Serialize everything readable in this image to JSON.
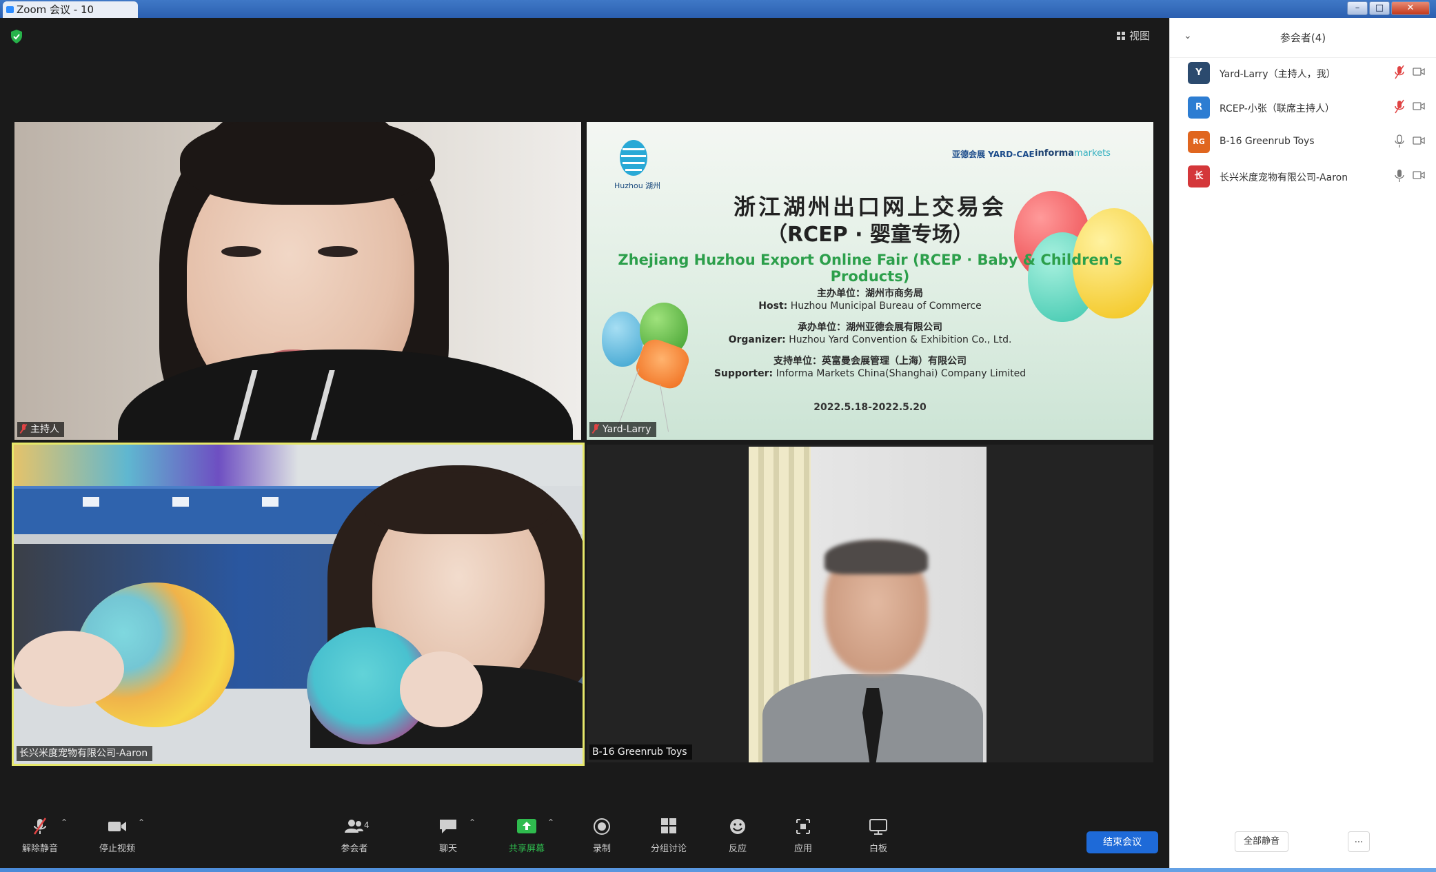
{
  "window": {
    "title": "Zoom 会议 - 10",
    "minimize": "–",
    "maximize": "□",
    "close": "✕"
  },
  "meeting": {
    "view_label": "视图",
    "tiles": [
      {
        "name": "主持人"
      },
      {
        "name": "Yard-Larry"
      },
      {
        "name": "长兴米度宠物有限公司-Aaron"
      },
      {
        "name": "B-16 Greenrub Toys"
      }
    ],
    "slide": {
      "left_logo_text": "Huzhou 湖州",
      "yard_logo": "亚德会展 YARD-CAE",
      "informa_logo_a": "informa",
      "informa_logo_b": "markets",
      "title_cn": "浙江湖州出口网上交易会",
      "subtitle_cn": "（RCEP · 婴童专场）",
      "title_en": "Zhejiang Huzhou Export Online Fair (RCEP · Baby & Children's Products)",
      "host_cn": "主办单位：湖州市商务局",
      "host_en_label": "Host:",
      "host_en": "Huzhou Municipal Bureau of Commerce",
      "org_cn": "承办单位：湖州亚德会展有限公司",
      "org_en_label": "Organizer:",
      "org_en": "Huzhou Yard Convention & Exhibition Co., Ltd.",
      "sup_cn": "支持单位：英富曼会展管理（上海）有限公司",
      "sup_en_label": "Supporter:",
      "sup_en": "Informa Markets China(Shanghai) Company Limited",
      "date": "2022.5.18-2022.5.20"
    }
  },
  "toolbar": {
    "items": [
      {
        "label": "解除静音"
      },
      {
        "label": "停止视频"
      },
      {
        "label": "参会者",
        "count": "4"
      },
      {
        "label": "聊天"
      },
      {
        "label": "共享屏幕"
      },
      {
        "label": "录制"
      },
      {
        "label": "分组讨论"
      },
      {
        "label": "反应"
      },
      {
        "label": "应用"
      },
      {
        "label": "白板"
      }
    ],
    "end_label": "结束会议"
  },
  "panel": {
    "title": "参会者(4)",
    "collapse": "⌄",
    "participants": [
      {
        "initial": "Y",
        "name": "Yard-Larry（主持人，我）",
        "color": "#2b4a6e"
      },
      {
        "initial": "R",
        "name": "RCEP-小张（联席主持人）",
        "color": "#2d7dd2"
      },
      {
        "initial": "RG",
        "name": "B-16 Greenrub Toys",
        "color": "#e0661f"
      },
      {
        "initial": "长",
        "name": "长兴米度宠物有限公司-Aaron",
        "color": "#d4373a"
      }
    ],
    "invite_label": "全部静音",
    "more_label": "..."
  },
  "colors": {
    "accent": "#1e6ad8",
    "share_green": "#2fbb4e",
    "mute_red": "#e04343",
    "speaking": "#e6e86a"
  }
}
